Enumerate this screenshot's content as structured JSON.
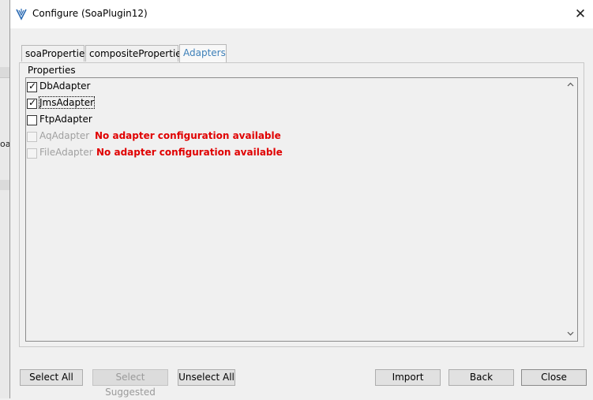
{
  "window": {
    "title": "Configure (SoaPlugin12)",
    "close_glyph": "✕",
    "background_fragment": "oa"
  },
  "tabs": [
    {
      "label": "soaProperties",
      "active": false
    },
    {
      "label": "compositeProperties",
      "active": false
    },
    {
      "label": "Adapters",
      "active": true
    }
  ],
  "panel": {
    "group_title": "Properties",
    "adapters": [
      {
        "name": "DbAdapter",
        "checked": true,
        "enabled": true,
        "message": ""
      },
      {
        "name": "JmsAdapter",
        "checked": true,
        "enabled": true,
        "message": "",
        "focused": true
      },
      {
        "name": "FtpAdapter",
        "checked": false,
        "enabled": true,
        "message": ""
      },
      {
        "name": "AqAdapter",
        "checked": false,
        "enabled": false,
        "message": "No adapter configuration available"
      },
      {
        "name": "FileAdapter",
        "checked": false,
        "enabled": false,
        "message": "No adapter configuration available"
      }
    ]
  },
  "buttons": {
    "select_all": "Select All",
    "select_suggested": "Select Suggested",
    "unselect_all": "Unselect All",
    "import": "Import",
    "back": "Back",
    "close": "Close"
  },
  "colors": {
    "accent_tab_text": "#3c7fb8",
    "warning_text": "#e00000",
    "icon_blue": "#2a6ab3"
  },
  "icons": {
    "app": "jdeveloper-icon",
    "scroll_up": "chevron-up-icon",
    "scroll_down": "chevron-down-icon",
    "check": "checkmark-icon"
  }
}
